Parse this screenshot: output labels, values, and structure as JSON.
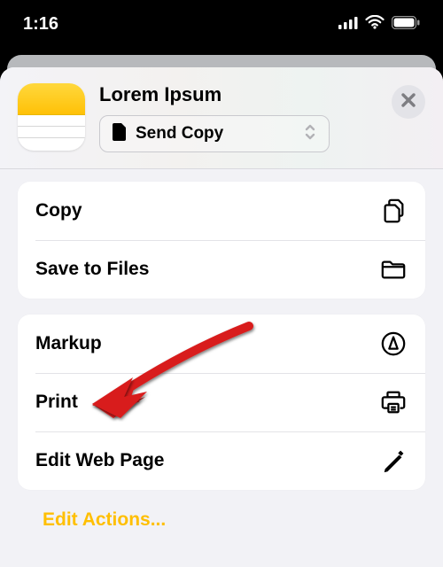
{
  "status": {
    "time": "1:16"
  },
  "header": {
    "title": "Lorem Ipsum",
    "sendCopy": "Send Copy"
  },
  "groups": [
    {
      "rows": [
        {
          "label": "Copy",
          "icon": "doc-on-doc-icon"
        },
        {
          "label": "Save to Files",
          "icon": "folder-icon"
        }
      ]
    },
    {
      "rows": [
        {
          "label": "Markup",
          "icon": "markup-icon"
        },
        {
          "label": "Print",
          "icon": "printer-icon"
        },
        {
          "label": "Edit Web Page",
          "icon": "pencil-icon"
        }
      ]
    }
  ],
  "footer": {
    "editActions": "Edit Actions..."
  }
}
